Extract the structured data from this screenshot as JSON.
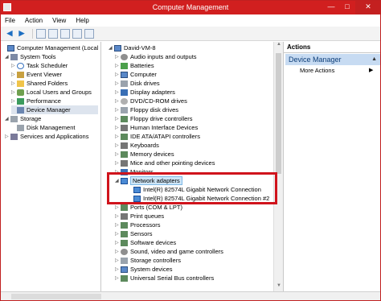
{
  "window": {
    "title": "Computer Management",
    "controls": {
      "minimize": "—",
      "maximize": "□",
      "close": "✕"
    }
  },
  "menu": [
    "File",
    "Action",
    "View",
    "Help"
  ],
  "left_tree": [
    {
      "label": "Computer Management (Local",
      "icon": "computer-icon",
      "expander": ""
    },
    {
      "label": "System Tools",
      "icon": "tools-icon",
      "expander": "◢"
    },
    {
      "label": "Task Scheduler",
      "icon": "clock-icon",
      "expander": "▷"
    },
    {
      "label": "Event Viewer",
      "icon": "event-icon",
      "expander": "▷"
    },
    {
      "label": "Shared Folders",
      "icon": "folder-icon",
      "expander": "▷"
    },
    {
      "label": "Local Users and Groups",
      "icon": "users-icon",
      "expander": "▷"
    },
    {
      "label": "Performance",
      "icon": "performance-icon",
      "expander": "▷"
    },
    {
      "label": "Device Manager",
      "icon": "device-manager-icon",
      "expander": "",
      "selected": true
    },
    {
      "label": "Storage",
      "icon": "storage-icon",
      "expander": "◢"
    },
    {
      "label": "Disk Management",
      "icon": "disk-icon",
      "expander": ""
    },
    {
      "label": "Services and Applications",
      "icon": "services-icon",
      "expander": "▷"
    }
  ],
  "device_tree": {
    "root": "David-VM-8",
    "items": [
      {
        "label": "Audio inputs and outputs",
        "icon": "audio-icon"
      },
      {
        "label": "Batteries",
        "icon": "battery-icon"
      },
      {
        "label": "Computer",
        "icon": "computer-icon"
      },
      {
        "label": "Disk drives",
        "icon": "disk-icon"
      },
      {
        "label": "Display adapters",
        "icon": "display-icon"
      },
      {
        "label": "DVD/CD-ROM drives",
        "icon": "dvd-icon"
      },
      {
        "label": "Floppy disk drives",
        "icon": "floppy-icon"
      },
      {
        "label": "Floppy drive controllers",
        "icon": "controller-icon"
      },
      {
        "label": "Human Interface Devices",
        "icon": "hid-icon"
      },
      {
        "label": "IDE ATA/ATAPI controllers",
        "icon": "ide-icon"
      },
      {
        "label": "Keyboards",
        "icon": "keyboard-icon"
      },
      {
        "label": "Memory devices",
        "icon": "memory-icon"
      },
      {
        "label": "Mice and other pointing devices",
        "icon": "mouse-icon"
      },
      {
        "label": "Monitors",
        "icon": "monitor-icon"
      },
      {
        "label": "Network adapters",
        "icon": "network-icon",
        "expanded": true,
        "selected": true
      },
      {
        "label": "Intel(R) 82574L Gigabit Network Connection",
        "icon": "network-adapter-icon",
        "child": true
      },
      {
        "label": "Intel(R) 82574L Gigabit Network Connection #2",
        "icon": "network-adapter-icon",
        "child": true
      },
      {
        "label": "Ports (COM & LPT)",
        "icon": "ports-icon"
      },
      {
        "label": "Print queues",
        "icon": "printer-icon"
      },
      {
        "label": "Processors",
        "icon": "processor-icon"
      },
      {
        "label": "Sensors",
        "icon": "sensor-icon"
      },
      {
        "label": "Software devices",
        "icon": "software-icon"
      },
      {
        "label": "Sound, video and game controllers",
        "icon": "sound-icon"
      },
      {
        "label": "Storage controllers",
        "icon": "storage-icon"
      },
      {
        "label": "System devices",
        "icon": "system-icon"
      },
      {
        "label": "Universal Serial Bus controllers",
        "icon": "usb-icon"
      }
    ]
  },
  "actions": {
    "header": "Actions",
    "section": "Device Manager",
    "items": [
      "More Actions"
    ]
  },
  "colors": {
    "titlebar": "#d11f1f",
    "highlight_box": "#d0141c",
    "actions_section": "#c7dbf2"
  }
}
